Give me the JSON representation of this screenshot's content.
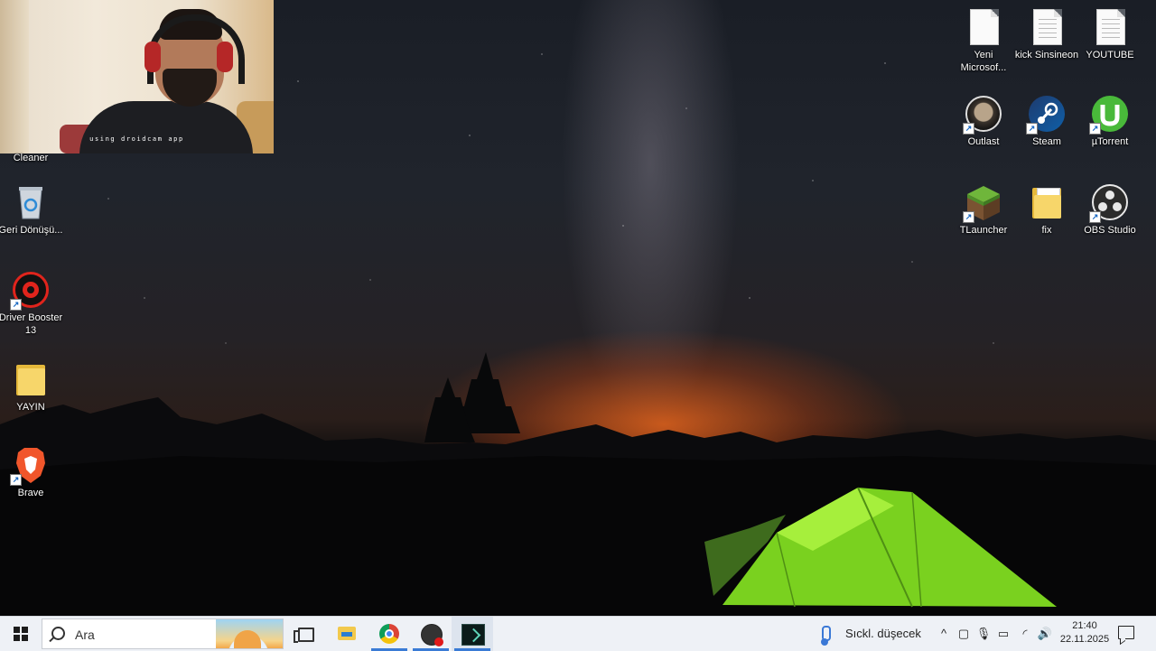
{
  "webcam": {
    "caption": "using droidcam app"
  },
  "desktop": {
    "left_icons": [
      {
        "label": "Cleaner"
      },
      {
        "label": "Geri Dönüşü..."
      },
      {
        "label": "Driver Booster 13"
      },
      {
        "label": "YAYIN"
      },
      {
        "label": "Brave"
      }
    ],
    "right_icons": [
      {
        "label": "Yeni Microsof..."
      },
      {
        "label": "kick Sinsineon"
      },
      {
        "label": "YOUTUBE"
      },
      {
        "label": "Outlast"
      },
      {
        "label": "Steam"
      },
      {
        "label": "µTorrent"
      },
      {
        "label": "TLauncher"
      },
      {
        "label": "fix"
      },
      {
        "label": "OBS Studio"
      }
    ]
  },
  "taskbar": {
    "search_placeholder": "Ara",
    "weather_text": "Sıckl. düşecek",
    "time": "21:40",
    "date": "22.11.2025",
    "pinned": [
      "task-view",
      "file-explorer",
      "chrome",
      "obs-studio",
      "terminal"
    ]
  },
  "colors": {
    "taskbar_bg": "#eef1f6",
    "active_indicator": "#3a7bd5"
  }
}
